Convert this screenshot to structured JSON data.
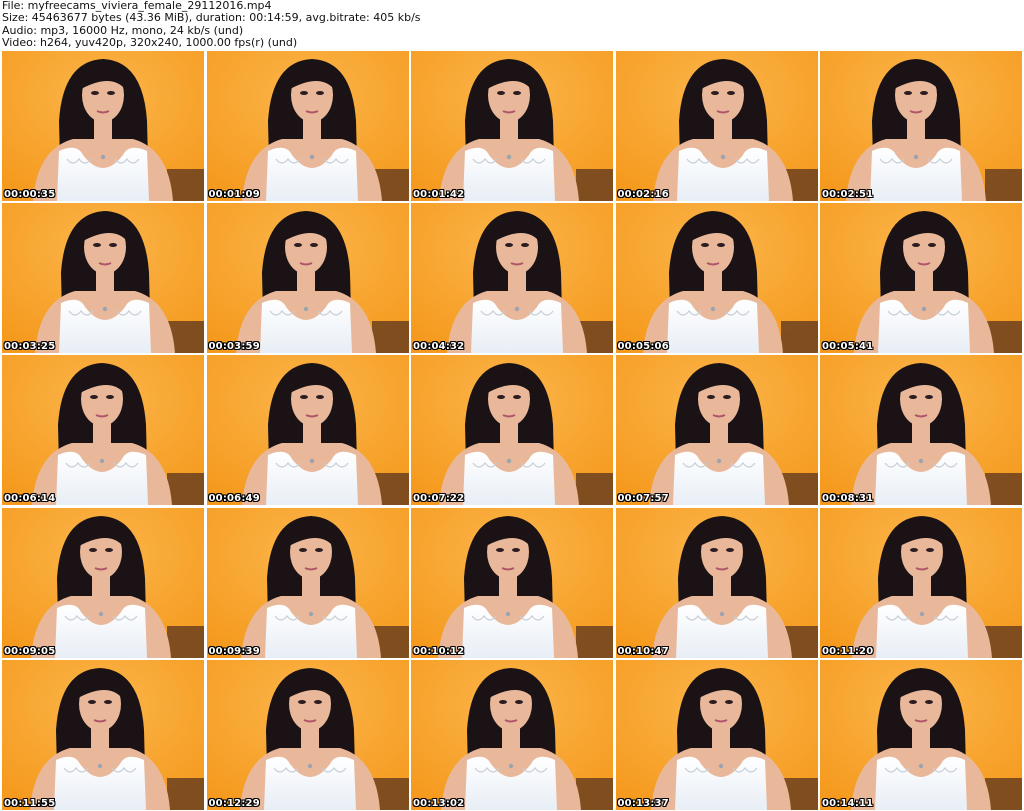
{
  "header": {
    "file": "File: myfreecams_viviera_female_29112016.mp4",
    "size": "Size: 45463677 bytes (43.36 MiB), duration: 00:14:59, avg.bitrate: 405 kb/s",
    "audio": "Audio: mp3, 16000 Hz, mono, 24 kb/s (und)",
    "video": "Video: h264, yuv420p, 320x240, 1000.00 fps(r) (und)"
  },
  "colors": {
    "background": "#ffffff",
    "wall": "#f59a1e",
    "wall_light": "#fbb54a",
    "hair": "#1a1214",
    "skin": "#e9b89a",
    "top": "#e8eef5",
    "timestamp_text": "#ffffff",
    "timestamp_outline": "#000000"
  },
  "thumbnails": [
    {
      "time": "00:00:35"
    },
    {
      "time": "00:01:09"
    },
    {
      "time": "00:01:42"
    },
    {
      "time": "00:02:16"
    },
    {
      "time": "00:02:51"
    },
    {
      "time": "00:03:25"
    },
    {
      "time": "00:03:59"
    },
    {
      "time": "00:04:32"
    },
    {
      "time": "00:05:06"
    },
    {
      "time": "00:05:41"
    },
    {
      "time": "00:06:14"
    },
    {
      "time": "00:06:49"
    },
    {
      "time": "00:07:22"
    },
    {
      "time": "00:07:57"
    },
    {
      "time": "00:08:31"
    },
    {
      "time": "00:09:05"
    },
    {
      "time": "00:09:39"
    },
    {
      "time": "00:10:12"
    },
    {
      "time": "00:10:47"
    },
    {
      "time": "00:11:20"
    },
    {
      "time": "00:11:55"
    },
    {
      "time": "00:12:29"
    },
    {
      "time": "00:13:02"
    },
    {
      "time": "00:13:37"
    },
    {
      "time": "00:14:11"
    }
  ]
}
